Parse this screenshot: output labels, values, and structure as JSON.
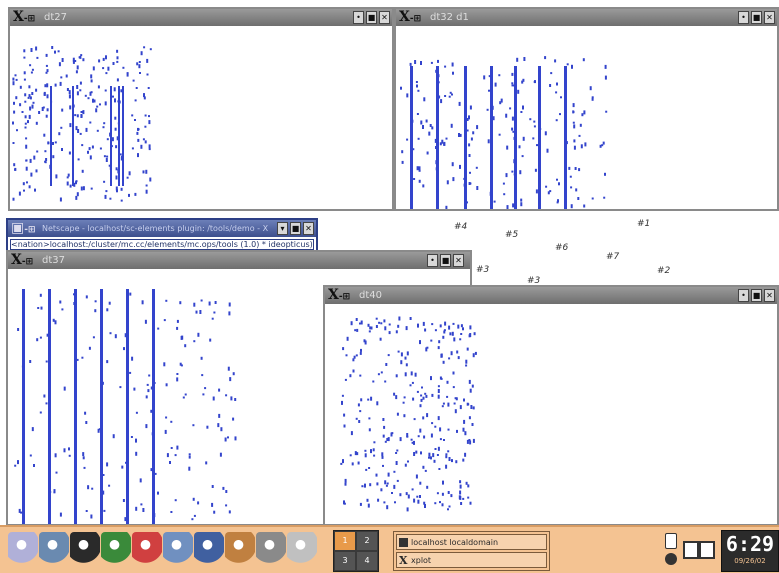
{
  "windows": {
    "top_left": {
      "title": "dt27",
      "buttons": [
        "•",
        "■",
        "✕"
      ]
    },
    "top_right": {
      "title": "dt32 d1",
      "buttons": [
        "•",
        "■",
        "✕"
      ]
    },
    "browser": {
      "title": "Netscape - localhost/sc-elements plugin: /tools/demo - X",
      "location": "<nation>localhost:/cluster/mc.cc/elements/mc.ops/tools (1.0) * ideopticus)",
      "buttons": [
        "▾",
        "■",
        "✕"
      ]
    },
    "mid_left": {
      "title": "dt37",
      "buttons": [
        "•",
        "■",
        "✕"
      ]
    },
    "mid_right": {
      "title": "dt40",
      "buttons": [
        "•",
        "■",
        "✕"
      ]
    }
  },
  "desktop_labels": [
    "#4",
    "#5",
    "#6",
    "#1",
    "#7",
    "#2",
    "#3",
    "#3"
  ],
  "taskbar": {
    "launchers": [
      "gnome-foot-icon",
      "compass-icon",
      "cursor-icon",
      "terminal-icon",
      "lifesaver-icon",
      "people-icon",
      "globe-icon",
      "paint-icon",
      "tools-icon",
      "pencil-icon"
    ],
    "pager": [
      "1",
      "2",
      "3",
      "4"
    ],
    "tasks": [
      "localhost localdomain",
      "xplot"
    ],
    "clock_time": "6:29",
    "clock_date": "09/26/02"
  },
  "colors": {
    "taskbar": "#f4c392",
    "plot_blue": "#3344cc"
  }
}
